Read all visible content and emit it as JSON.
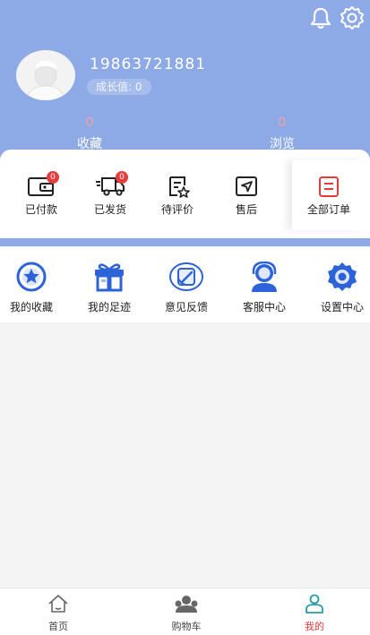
{
  "user": {
    "phone": "19863721881",
    "growth_label": "成长值: 0"
  },
  "stats": [
    {
      "count": "0",
      "label": "收藏"
    },
    {
      "count": "0",
      "label": "浏览"
    }
  ],
  "orders": [
    {
      "label": "已付款",
      "badge": "0",
      "icon": "wallet-icon"
    },
    {
      "label": "已发货",
      "badge": "0",
      "icon": "truck-icon"
    },
    {
      "label": "待评价",
      "icon": "review-icon"
    },
    {
      "label": "售后",
      "icon": "aftersale-icon"
    },
    {
      "label": "全部订单",
      "icon": "all-orders-icon"
    }
  ],
  "tools": [
    {
      "label": "我的收藏",
      "icon": "star-icon"
    },
    {
      "label": "我的足迹",
      "icon": "gift-icon"
    },
    {
      "label": "意见反馈",
      "icon": "feedback-icon"
    },
    {
      "label": "客服中心",
      "icon": "support-icon"
    },
    {
      "label": "设置中心",
      "icon": "settings-icon"
    }
  ],
  "tabs": [
    {
      "label": "首页",
      "icon": "home-icon",
      "active": false
    },
    {
      "label": "购物车",
      "icon": "cart-icon",
      "active": false
    },
    {
      "label": "我的",
      "icon": "profile-icon",
      "active": true
    }
  ],
  "colors": {
    "header_bg": "#8eaae6",
    "accent_red": "#e23b3b",
    "icon_blue": "#2d63d8",
    "badge_red": "#e63c3c"
  }
}
